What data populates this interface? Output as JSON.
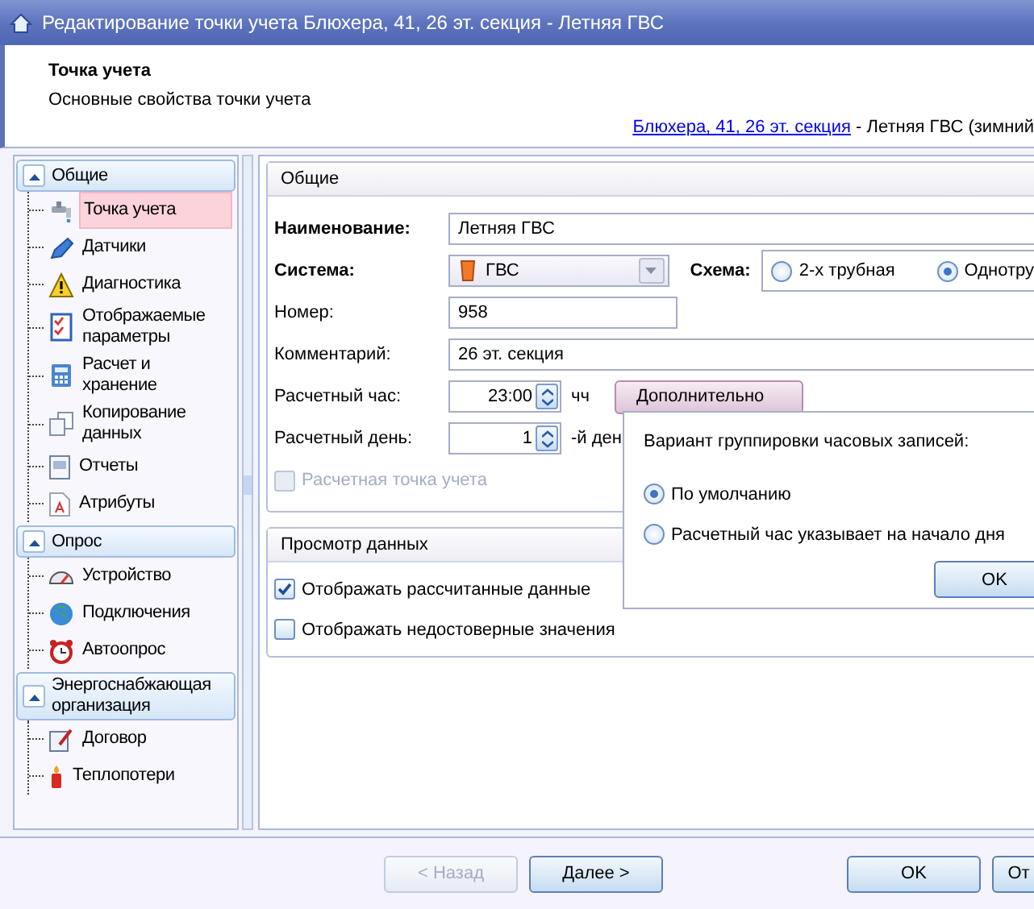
{
  "window": {
    "title": "Редактирование точки учета Блюхера, 41, 26 эт. секция - Летняя ГВС"
  },
  "header": {
    "title": "Точка учета",
    "subtitle": "Основные свойства точки учета",
    "breadcrumb_link": "Блюхера, 41, 26 эт. секция",
    "breadcrumb_rest": " - Летняя ГВС (зимний"
  },
  "sidebar": {
    "groups": [
      {
        "label": "Общие",
        "expanded": true,
        "items": [
          {
            "label": "Точка учета",
            "selected": true
          },
          {
            "label": "Датчики",
            "selected": false
          },
          {
            "label": "Диагностика",
            "selected": false
          },
          {
            "label": "Отображаемые параметры",
            "selected": false
          },
          {
            "label": "Расчет и хранение",
            "selected": false
          },
          {
            "label": "Копирование данных",
            "selected": false
          },
          {
            "label": "Отчеты",
            "selected": false
          },
          {
            "label": "Атрибуты",
            "selected": false
          }
        ]
      },
      {
        "label": "Опрос",
        "expanded": true,
        "items": [
          {
            "label": "Устройство",
            "selected": false
          },
          {
            "label": "Подключения",
            "selected": false
          },
          {
            "label": "Автоопрос",
            "selected": false
          }
        ]
      },
      {
        "label": "Энергоснабжающая организация",
        "expanded": true,
        "items": [
          {
            "label": "Договор",
            "selected": false
          },
          {
            "label": "Теплопотери",
            "selected": false
          }
        ]
      }
    ]
  },
  "general": {
    "title": "Общие",
    "name": {
      "label": "Наименование:",
      "value": "Летняя ГВС"
    },
    "system": {
      "label": "Система:",
      "value": "ГВС"
    },
    "scheme": {
      "label": "Схема:",
      "options": [
        {
          "label": "2-х трубная",
          "selected": false
        },
        {
          "label": "Однотру",
          "selected": true
        }
      ]
    },
    "number": {
      "label": "Номер:",
      "value": "958"
    },
    "comment": {
      "label": "Комментарий:",
      "value": "26 эт. секция"
    },
    "hour": {
      "label": "Расчетный час:",
      "value": "23:00",
      "unit": "чч",
      "button": "Дополнительно"
    },
    "day": {
      "label": "Расчетный день:",
      "value": "1",
      "unit": "-й ден"
    },
    "billing_point": {
      "label": "Расчетная точка учета",
      "checked": false,
      "disabled": true
    }
  },
  "data_view": {
    "title": "Просмотр данных",
    "options": [
      {
        "label": "Отображать рассчитанные данные",
        "checked": true
      },
      {
        "label": "Отображать недостоверные значения",
        "checked": false
      }
    ]
  },
  "popup": {
    "title": "Вариант группировки часовых записей:",
    "options": [
      {
        "label": "По умолчанию",
        "selected": true
      },
      {
        "label": "Расчетный час указывает на начало дня",
        "selected": false
      }
    ],
    "ok": "OK"
  },
  "footer": {
    "buttons": [
      {
        "label": "< Назад",
        "disabled": true
      },
      {
        "label": "Далее >",
        "disabled": false
      },
      {
        "label": "OK",
        "disabled": false
      },
      {
        "label": "От",
        "disabled": false
      }
    ]
  }
}
